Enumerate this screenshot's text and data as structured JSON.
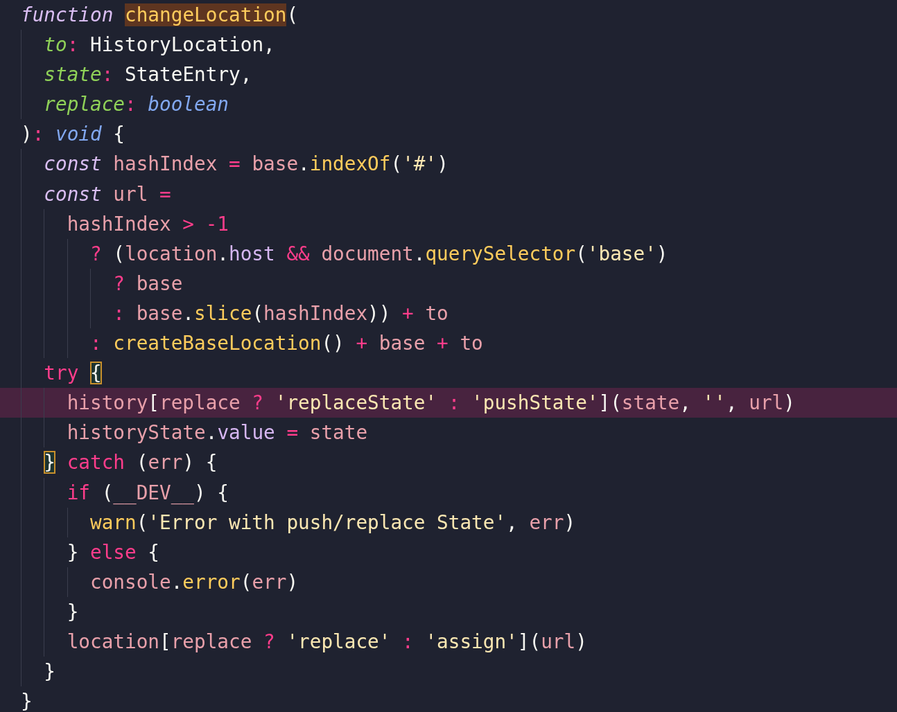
{
  "lines": [
    {
      "tokens": [
        {
          "text": "function ",
          "kind": "kw"
        },
        {
          "text": "changeLocation",
          "kind": "fn",
          "word_highlight": true
        },
        {
          "text": "(",
          "kind": "punc"
        }
      ],
      "children": [
        {
          "tokens": [
            {
              "text": "to",
              "kind": "param"
            },
            {
              "text": ":",
              "kind": "op"
            },
            {
              "text": " HistoryLocation,",
              "kind": "type"
            }
          ]
        },
        {
          "tokens": [
            {
              "text": "state",
              "kind": "param"
            },
            {
              "text": ":",
              "kind": "op"
            },
            {
              "text": " StateEntry,",
              "kind": "type"
            }
          ]
        },
        {
          "tokens": [
            {
              "text": "replace",
              "kind": "param"
            },
            {
              "text": ":",
              "kind": "op"
            },
            {
              "text": " boolean",
              "kind": "btype"
            }
          ]
        }
      ]
    },
    {
      "tokens": [
        {
          "text": ")",
          "kind": "punc"
        },
        {
          "text": ":",
          "kind": "op"
        },
        {
          "text": " void",
          "kind": "btype"
        },
        {
          "text": " {",
          "kind": "punc"
        }
      ],
      "children": [
        {
          "tokens": [
            {
              "text": "const",
              "kind": "kw"
            },
            {
              "text": " hashIndex",
              "kind": "var"
            },
            {
              "text": " = ",
              "kind": "op"
            },
            {
              "text": "base",
              "kind": "var"
            },
            {
              "text": ".",
              "kind": "punc"
            },
            {
              "text": "indexOf",
              "kind": "fn"
            },
            {
              "text": "(",
              "kind": "punc"
            },
            {
              "text": "'#'",
              "kind": "str"
            },
            {
              "text": ")",
              "kind": "punc"
            }
          ]
        },
        {
          "tokens": [
            {
              "text": "const",
              "kind": "kw"
            },
            {
              "text": " url",
              "kind": "var"
            },
            {
              "text": " =",
              "kind": "op"
            }
          ],
          "children": [
            {
              "tokens": [
                {
                  "text": "hashIndex",
                  "kind": "var"
                },
                {
                  "text": " > -1",
                  "kind": "op"
                }
              ],
              "children": [
                {
                  "tokens": [
                    {
                      "text": "? ",
                      "kind": "op"
                    },
                    {
                      "text": "(",
                      "kind": "punc"
                    },
                    {
                      "text": "location",
                      "kind": "var"
                    },
                    {
                      "text": ".",
                      "kind": "punc"
                    },
                    {
                      "text": "host",
                      "kind": "prop"
                    },
                    {
                      "text": " && ",
                      "kind": "op"
                    },
                    {
                      "text": "document",
                      "kind": "var"
                    },
                    {
                      "text": ".",
                      "kind": "punc"
                    },
                    {
                      "text": "querySelector",
                      "kind": "fn"
                    },
                    {
                      "text": "(",
                      "kind": "punc"
                    },
                    {
                      "text": "'base'",
                      "kind": "str"
                    },
                    {
                      "text": ")",
                      "kind": "punc"
                    }
                  ],
                  "children": [
                    {
                      "tokens": [
                        {
                          "text": "? ",
                          "kind": "op"
                        },
                        {
                          "text": "base",
                          "kind": "var"
                        }
                      ]
                    },
                    {
                      "tokens": [
                        {
                          "text": ": ",
                          "kind": "op"
                        },
                        {
                          "text": "base",
                          "kind": "var"
                        },
                        {
                          "text": ".",
                          "kind": "punc"
                        },
                        {
                          "text": "slice",
                          "kind": "fn"
                        },
                        {
                          "text": "(",
                          "kind": "punc"
                        },
                        {
                          "text": "hashIndex",
                          "kind": "var"
                        },
                        {
                          "text": "))",
                          "kind": "punc"
                        },
                        {
                          "text": " + ",
                          "kind": "op"
                        },
                        {
                          "text": "to",
                          "kind": "var"
                        }
                      ]
                    }
                  ]
                },
                {
                  "tokens": [
                    {
                      "text": ": ",
                      "kind": "op"
                    },
                    {
                      "text": "createBaseLocation",
                      "kind": "fn"
                    },
                    {
                      "text": "() ",
                      "kind": "punc"
                    },
                    {
                      "text": "+ ",
                      "kind": "op"
                    },
                    {
                      "text": "base",
                      "kind": "var"
                    },
                    {
                      "text": " + ",
                      "kind": "op"
                    },
                    {
                      "text": "to",
                      "kind": "var"
                    }
                  ]
                }
              ]
            }
          ]
        },
        {
          "tokens": [
            {
              "text": "try ",
              "kind": "ctrl"
            },
            {
              "text": "{",
              "kind": "punc",
              "bracket_match": true
            }
          ],
          "children": [
            {
              "highlighted": true,
              "tokens": [
                {
                  "text": "history",
                  "kind": "var"
                },
                {
                  "text": "[",
                  "kind": "punc"
                },
                {
                  "text": "replace",
                  "kind": "var"
                },
                {
                  "text": " ? ",
                  "kind": "op"
                },
                {
                  "text": "'replaceState'",
                  "kind": "str"
                },
                {
                  "text": " : ",
                  "kind": "op"
                },
                {
                  "text": "'pushState'",
                  "kind": "str"
                },
                {
                  "text": "](",
                  "kind": "punc"
                },
                {
                  "text": "state",
                  "kind": "var"
                },
                {
                  "text": ", ",
                  "kind": "punc"
                },
                {
                  "text": "''",
                  "kind": "str"
                },
                {
                  "text": ", ",
                  "kind": "punc"
                },
                {
                  "text": "url",
                  "kind": "var"
                },
                {
                  "text": ")",
                  "kind": "punc"
                }
              ]
            },
            {
              "tokens": [
                {
                  "text": "historyState",
                  "kind": "var"
                },
                {
                  "text": ".",
                  "kind": "punc"
                },
                {
                  "text": "value",
                  "kind": "prop"
                },
                {
                  "text": " = ",
                  "kind": "op"
                },
                {
                  "text": "state",
                  "kind": "var"
                }
              ]
            }
          ]
        },
        {
          "tokens": [
            {
              "text": "}",
              "kind": "punc",
              "bracket_match": true
            },
            {
              "text": " catch",
              "kind": "ctrl"
            },
            {
              "text": " (",
              "kind": "punc"
            },
            {
              "text": "err",
              "kind": "var"
            },
            {
              "text": ") {",
              "kind": "punc"
            }
          ],
          "children": [
            {
              "tokens": [
                {
                  "text": "if",
                  "kind": "ctrl"
                },
                {
                  "text": " (",
                  "kind": "punc"
                },
                {
                  "text": "__DEV__",
                  "kind": "var"
                },
                {
                  "text": ") {",
                  "kind": "punc"
                }
              ],
              "children": [
                {
                  "tokens": [
                    {
                      "text": "warn",
                      "kind": "fn"
                    },
                    {
                      "text": "(",
                      "kind": "punc"
                    },
                    {
                      "text": "'Error with push/replace State'",
                      "kind": "str"
                    },
                    {
                      "text": ", ",
                      "kind": "punc"
                    },
                    {
                      "text": "err",
                      "kind": "var"
                    },
                    {
                      "text": ")",
                      "kind": "punc"
                    }
                  ]
                }
              ]
            },
            {
              "tokens": [
                {
                  "text": "} ",
                  "kind": "punc"
                },
                {
                  "text": "else",
                  "kind": "ctrl"
                },
                {
                  "text": " {",
                  "kind": "punc"
                }
              ],
              "children": [
                {
                  "tokens": [
                    {
                      "text": "console",
                      "kind": "var"
                    },
                    {
                      "text": ".",
                      "kind": "punc"
                    },
                    {
                      "text": "error",
                      "kind": "fn"
                    },
                    {
                      "text": "(",
                      "kind": "punc"
                    },
                    {
                      "text": "err",
                      "kind": "var"
                    },
                    {
                      "text": ")",
                      "kind": "punc"
                    }
                  ]
                }
              ]
            },
            {
              "tokens": [
                {
                  "text": "}",
                  "kind": "punc"
                }
              ]
            },
            {
              "tokens": [
                {
                  "text": "location",
                  "kind": "var"
                },
                {
                  "text": "[",
                  "kind": "punc"
                },
                {
                  "text": "replace",
                  "kind": "var"
                },
                {
                  "text": " ? ",
                  "kind": "op"
                },
                {
                  "text": "'replace'",
                  "kind": "str"
                },
                {
                  "text": " : ",
                  "kind": "op"
                },
                {
                  "text": "'assign'",
                  "kind": "str"
                },
                {
                  "text": "](",
                  "kind": "punc"
                },
                {
                  "text": "url",
                  "kind": "var"
                },
                {
                  "text": ")",
                  "kind": "punc"
                }
              ]
            }
          ]
        },
        {
          "tokens": [
            {
              "text": "}",
              "kind": "punc"
            }
          ]
        }
      ]
    },
    {
      "tokens": [
        {
          "text": "}",
          "kind": "punc"
        }
      ]
    }
  ]
}
